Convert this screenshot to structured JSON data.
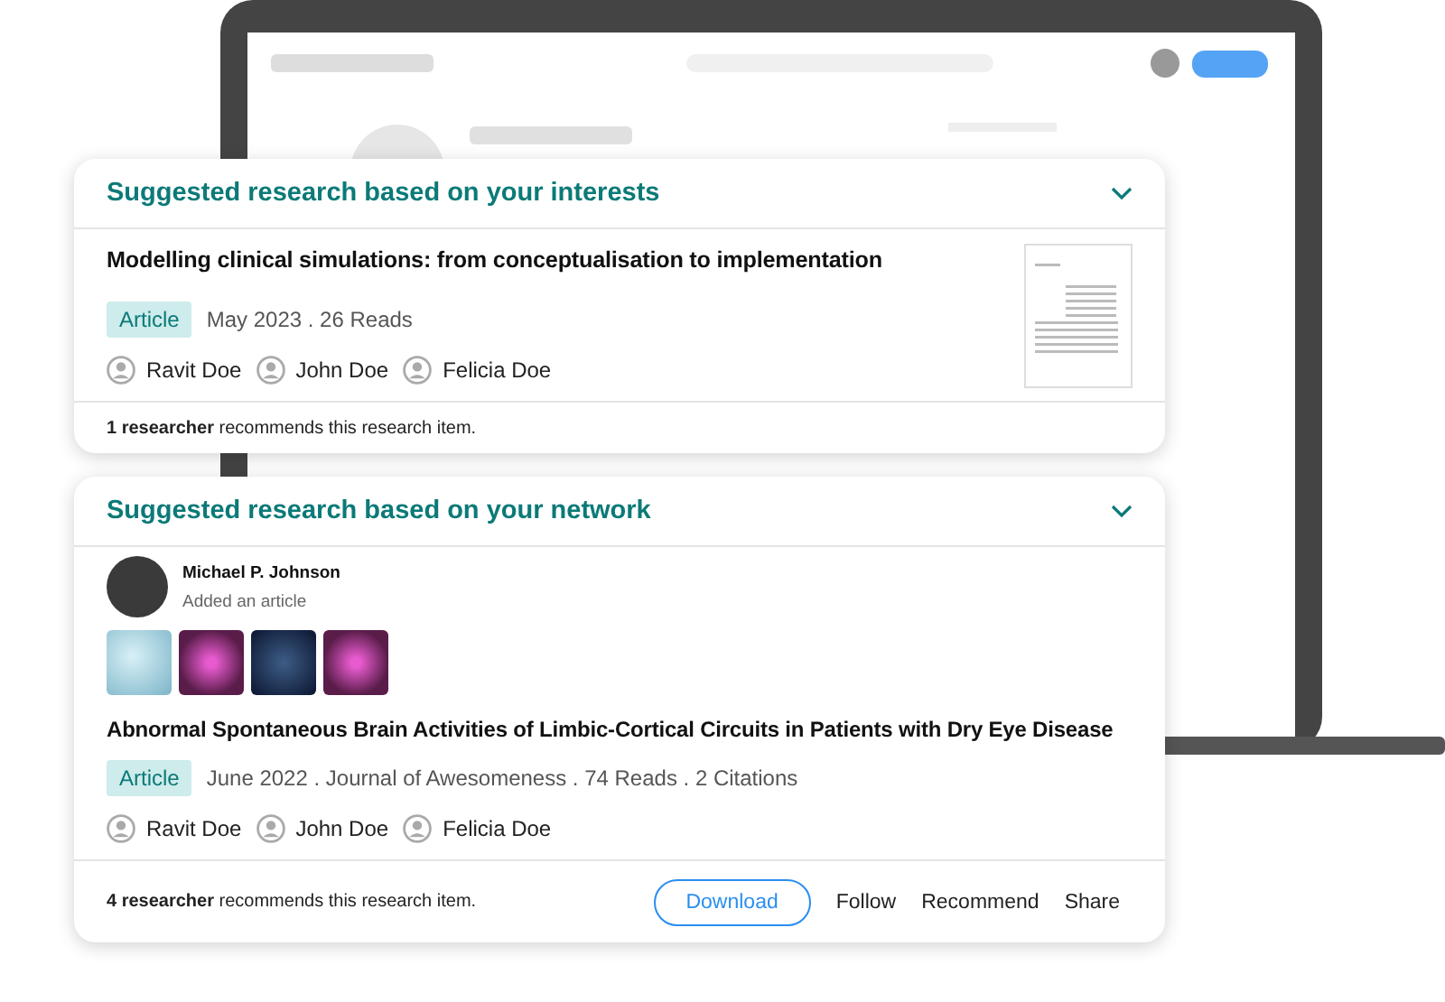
{
  "cards": [
    {
      "header": "Suggested research based on your interests",
      "kind": "interests",
      "title": "Modelling clinical simulations: from conceptualisation to implementation",
      "badge": "Article",
      "meta": "May 2023 . 26 Reads",
      "authors": [
        "Ravit Doe",
        "John Doe",
        "Felicia Doe"
      ],
      "recommendation": "**1 researcher** recommends this research item."
    },
    {
      "header": "Suggested research based on your network",
      "kind": "network",
      "poster": {
        "name": "Michael P. Johnson",
        "activity": "Added an article"
      },
      "title": "Abnormal Spontaneous Brain Activities of Limbic-Cortical Circuits in Patients with Dry Eye Disease",
      "badge": "Article",
      "meta": "June 2022 . Journal of Awesomeness . 74 Reads . 2 Citations",
      "authors": [
        "Ravit Doe",
        "John Doe",
        "Felicia Doe"
      ],
      "recommendation": "**4 researcher** recommends this research item.",
      "actions": [
        {
          "label": "Download",
          "kind": "outlined"
        },
        {
          "label": "Follow",
          "kind": "text"
        },
        {
          "label": "Recommend",
          "kind": "text"
        },
        {
          "label": "Share",
          "kind": "text"
        }
      ]
    }
  ]
}
